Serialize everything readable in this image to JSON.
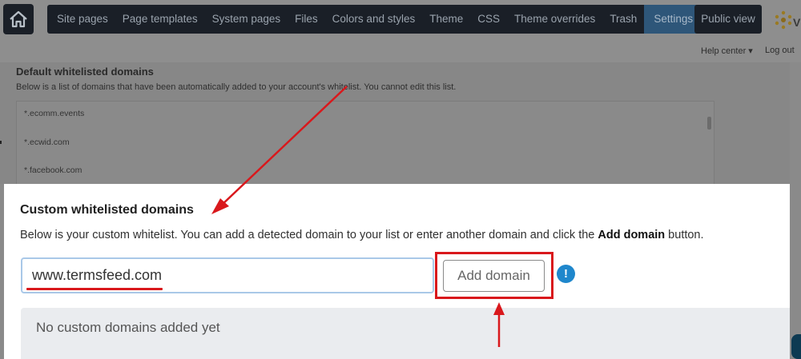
{
  "nav": {
    "items": [
      "Site pages",
      "Page templates",
      "System pages",
      "Files",
      "Colors and styles",
      "Theme",
      "CSS",
      "Theme overrides"
    ],
    "trash": "Trash",
    "settings": "Settings",
    "public_view": "Public view"
  },
  "subnav": {
    "help_center": "Help center ▾",
    "log_out": "Log out"
  },
  "default_section": {
    "heading": "Default whitelisted domains",
    "description": "Below is a list of domains that have been automatically added to your account's whitelist. You cannot edit this list.",
    "domains": [
      "*.ecomm.events",
      "*.ecwid.com",
      "*.facebook.com"
    ]
  },
  "custom_section": {
    "title": "Custom whitelisted domains",
    "description_prefix": "Below is your custom whitelist. You can add a detected domain to your list or enter another domain and click the ",
    "description_bold": "Add domain",
    "description_suffix": " button.",
    "input_value": "www.termsfeed.com",
    "add_button": "Add domain",
    "info_glyph": "!",
    "empty_message": "No custom domains added yet"
  },
  "icons": {
    "home": "home-icon",
    "info": "info-icon",
    "caret": "caret-down-icon"
  },
  "colors": {
    "nav_bg": "#1a1f27",
    "nav_active": "#2e5679",
    "annotation_red": "#d9181c",
    "info_blue": "#1f87cc",
    "input_focus": "#a9c8e8",
    "empty_panel": "#eaecef"
  }
}
